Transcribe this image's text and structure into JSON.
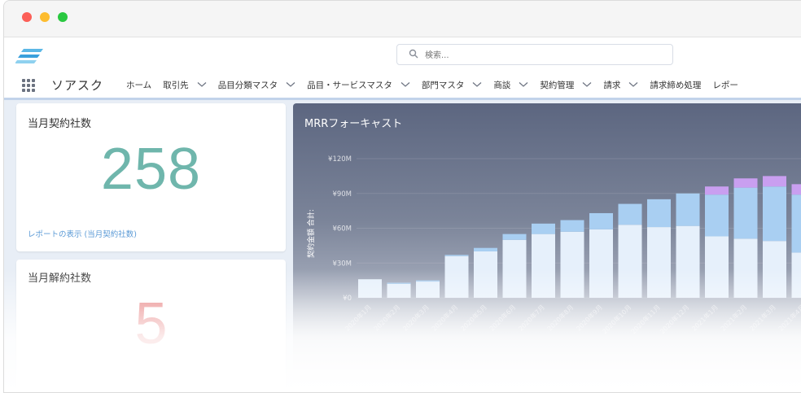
{
  "header": {
    "search": {
      "placeholder": "検索..."
    }
  },
  "nav": {
    "app_name": "ソアスク",
    "items": [
      {
        "label": "ホーム",
        "dropdown": false
      },
      {
        "label": "取引先",
        "dropdown": true
      },
      {
        "label": "品目分類マスタ",
        "dropdown": true
      },
      {
        "label": "品目・サービスマスタ",
        "dropdown": true
      },
      {
        "label": "部門マスタ",
        "dropdown": true
      },
      {
        "label": "商談",
        "dropdown": true
      },
      {
        "label": "契約管理",
        "dropdown": true
      },
      {
        "label": "請求",
        "dropdown": true
      },
      {
        "label": "請求締め処理",
        "dropdown": false
      },
      {
        "label": "レポー",
        "dropdown": false
      }
    ]
  },
  "cards": {
    "contracts": {
      "title": "当月契約社数",
      "value": "258",
      "link": "レポートの表示 (当月契約社数)"
    },
    "cancellations": {
      "title": "当月解約社数",
      "value": "5"
    }
  },
  "chart_data": {
    "type": "bar",
    "title": "MRRフォーキャスト",
    "ylabel": "契約金額 合計:",
    "yticks": [
      "¥120M",
      "¥90M",
      "¥60M",
      "¥30M",
      "¥0"
    ],
    "ylim": [
      0,
      120
    ],
    "categories": [
      "2020年1月",
      "2020年2月",
      "2020年3月",
      "2020年4月",
      "2020年5月",
      "2020年6月",
      "2020年7月",
      "2020年8月",
      "2020年9月",
      "2020年10月",
      "2020年11月",
      "2020年12月",
      "2021年1月",
      "2021年2月",
      "2021年3月",
      "2021年4月"
    ],
    "series": [
      {
        "color": "#e6f0fb",
        "values": [
          16,
          12,
          14,
          36,
          40,
          50,
          55,
          57,
          59,
          63,
          61,
          62,
          53,
          51,
          49,
          39
        ]
      },
      {
        "color": "#a9cff2",
        "values": [
          0,
          1,
          1,
          1,
          3,
          5,
          9,
          10,
          14,
          18,
          24,
          28,
          36,
          44,
          47,
          50
        ]
      },
      {
        "color": "#c99ff0",
        "values": [
          0,
          0,
          0,
          0,
          0,
          0,
          0,
          0,
          0,
          0,
          0,
          0,
          7,
          8,
          9,
          9
        ]
      }
    ]
  }
}
